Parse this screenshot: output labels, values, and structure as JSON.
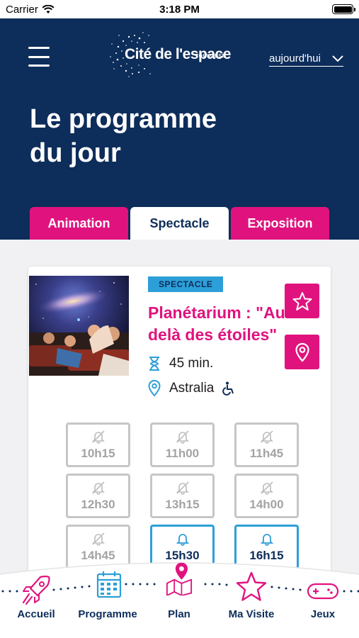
{
  "status_bar": {
    "carrier": "Carrier",
    "time": "3:18 PM"
  },
  "header": {
    "logo": {
      "city": "TOULOUSE",
      "name": "Cité de l'espace"
    },
    "date_selector": {
      "value": "aujourd'hui"
    },
    "page_title": "Le programme du jour"
  },
  "tabs": [
    {
      "label": "Animation",
      "active": false
    },
    {
      "label": "Spectacle",
      "active": true
    },
    {
      "label": "Exposition",
      "active": false
    }
  ],
  "event": {
    "category": "SPECTACLE",
    "title": "Planétarium : \"Au-delà des étoiles\"",
    "duration": "45 min.",
    "location": "Astralia",
    "accessible_icon": "wheelchair-icon",
    "slots": [
      {
        "time": "10h15",
        "status": "past",
        "icon": "bell-off-icon"
      },
      {
        "time": "11h00",
        "status": "past",
        "icon": "bell-off-icon"
      },
      {
        "time": "11h45",
        "status": "past",
        "icon": "bell-off-icon"
      },
      {
        "time": "12h30",
        "status": "past",
        "icon": "bell-off-icon"
      },
      {
        "time": "13h15",
        "status": "past",
        "icon": "bell-off-icon"
      },
      {
        "time": "14h00",
        "status": "past",
        "icon": "bell-off-icon"
      },
      {
        "time": "14h45",
        "status": "past",
        "icon": "bell-off-icon"
      },
      {
        "time": "15h30",
        "status": "open",
        "icon": "bell-icon"
      },
      {
        "time": "16h15",
        "status": "open",
        "icon": "bell-icon"
      }
    ]
  },
  "bottom_nav": [
    {
      "label": "Accueil",
      "icon": "rocket-icon"
    },
    {
      "label": "Programme",
      "icon": "calendar-icon"
    },
    {
      "label": "Plan",
      "icon": "map-pin-icon"
    },
    {
      "label": "Ma Visite",
      "icon": "star-icon"
    },
    {
      "label": "Jeux",
      "icon": "gamepad-icon"
    }
  ],
  "colors": {
    "navy": "#0d2d5a",
    "pink": "#e0137e",
    "blue": "#2d9fd8",
    "grey": "#a3a3a3"
  }
}
